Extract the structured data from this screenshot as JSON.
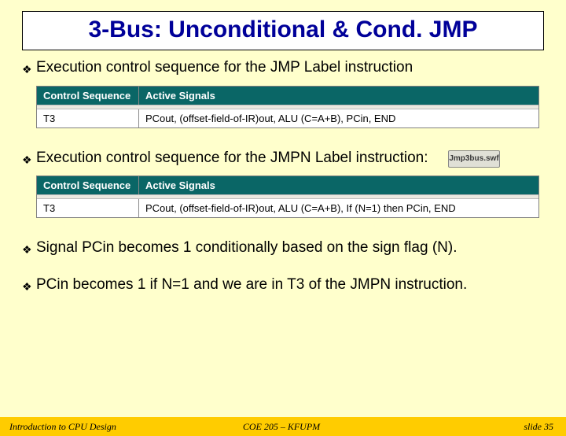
{
  "title": "3-Bus: Unconditional & Cond. JMP",
  "bullets": {
    "b1": "Execution control sequence for the JMP Label instruction",
    "b2": "Execution control sequence for the JMPN Label instruction:",
    "b3": "Signal PCin becomes 1 conditionally based on the sign flag (N).",
    "b4": "PCin becomes 1 if N=1 and we are in T3 of the JMPN instruction."
  },
  "link_label": "Jmp3bus.swf",
  "table1": {
    "headers": {
      "c1": "Control Sequence",
      "c2": "Active Signals"
    },
    "row": {
      "c1": "T3",
      "c2": "PCout, (offset-field-of-IR)out, ALU (C=A+B), PCin, END"
    }
  },
  "table2": {
    "headers": {
      "c1": "Control Sequence",
      "c2": "Active Signals"
    },
    "row": {
      "c1": "T3",
      "c2": "PCout, (offset-field-of-IR)out, ALU (C=A+B), If (N=1) then PCin, END"
    }
  },
  "footer": {
    "left": "Introduction to CPU Design",
    "center": "COE 205 – KFUPM",
    "right": "slide 35"
  }
}
